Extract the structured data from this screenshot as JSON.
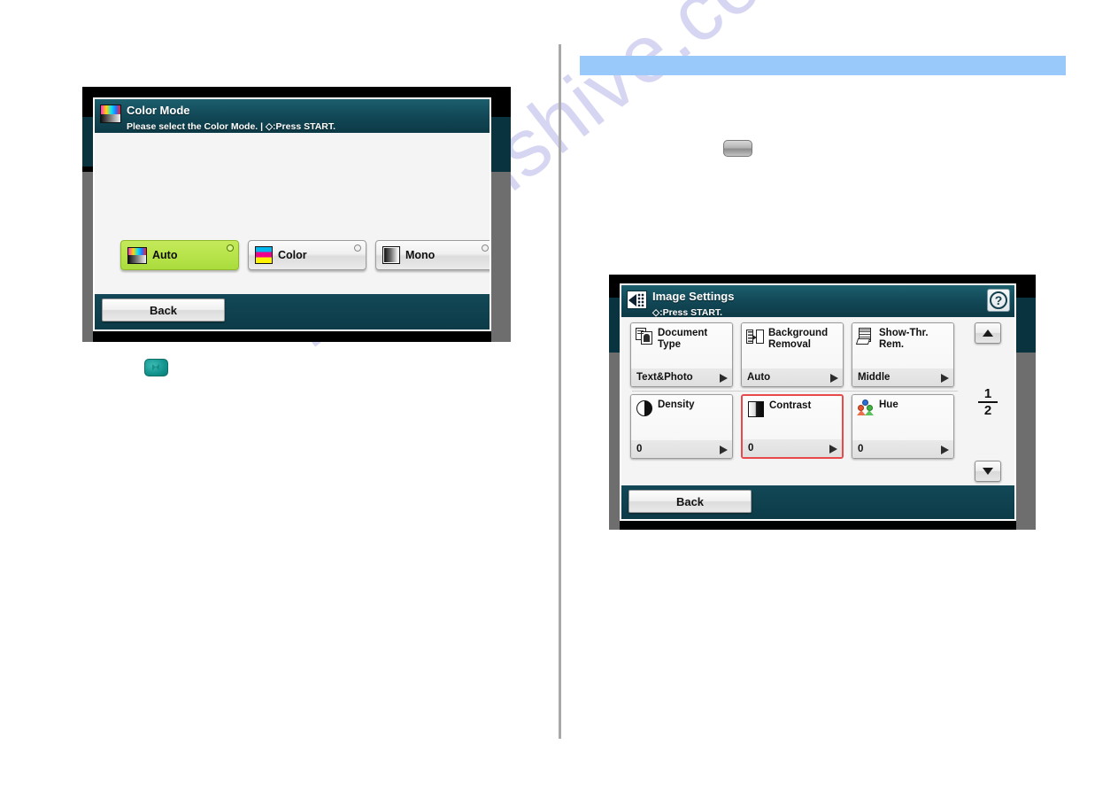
{
  "page": {
    "watermark": "manualshive.com"
  },
  "highlight_bar": {
    "name": "empty-highlight-band",
    "color": "#99c9fb",
    "text": ""
  },
  "hardware_keys": [
    {
      "name": "gray-hardware-key",
      "label": ""
    },
    {
      "name": "teal-start-key",
      "label": ""
    }
  ],
  "color_mode_screen": {
    "header": {
      "title": "Color Mode",
      "subtitle": "Please select the Color Mode. | ◇:Press START.",
      "icon": "color-mode-icon"
    },
    "options": [
      {
        "label": "Auto",
        "icon": "color-mode-icon",
        "selected": true
      },
      {
        "label": "Color",
        "icon": "cmy-color-icon",
        "selected": false
      },
      {
        "label": "Mono",
        "icon": "mono-gradient-icon",
        "selected": false
      }
    ],
    "footer": {
      "back_label": "Back"
    }
  },
  "image_settings_screen": {
    "header": {
      "title": "Image Settings",
      "subtitle": "◇:Press START.",
      "icon": "image-settings-icon",
      "help_label": "?"
    },
    "buttons": [
      {
        "title": "Document Type",
        "title_line1": "Document",
        "title_line2": "Type",
        "value": "Text&Photo",
        "icon": "document-type-icon",
        "highlighted": false
      },
      {
        "title": "Background Removal",
        "title_line1": "Background",
        "title_line2": "Removal",
        "value": "Auto",
        "icon": "background-removal-icon",
        "highlighted": false
      },
      {
        "title": "Show-Thr. Rem.",
        "title_line1": "Show-Thr.",
        "title_line2": "Rem.",
        "value": "Middle",
        "icon": "show-through-removal-icon",
        "highlighted": false
      },
      {
        "title": "Density",
        "title_line1": "Density",
        "title_line2": "",
        "value": "0",
        "icon": "density-icon",
        "highlighted": false
      },
      {
        "title": "Contrast",
        "title_line1": "Contrast",
        "title_line2": "",
        "value": "0",
        "icon": "contrast-icon",
        "highlighted": true
      },
      {
        "title": "Hue",
        "title_line1": "Hue",
        "title_line2": "",
        "value": "0",
        "icon": "hue-icon",
        "highlighted": false
      }
    ],
    "pagination": {
      "current": "1",
      "total": "2",
      "scroll_up": "▲",
      "scroll_down": "▼"
    },
    "footer": {
      "back_label": "Back"
    }
  }
}
